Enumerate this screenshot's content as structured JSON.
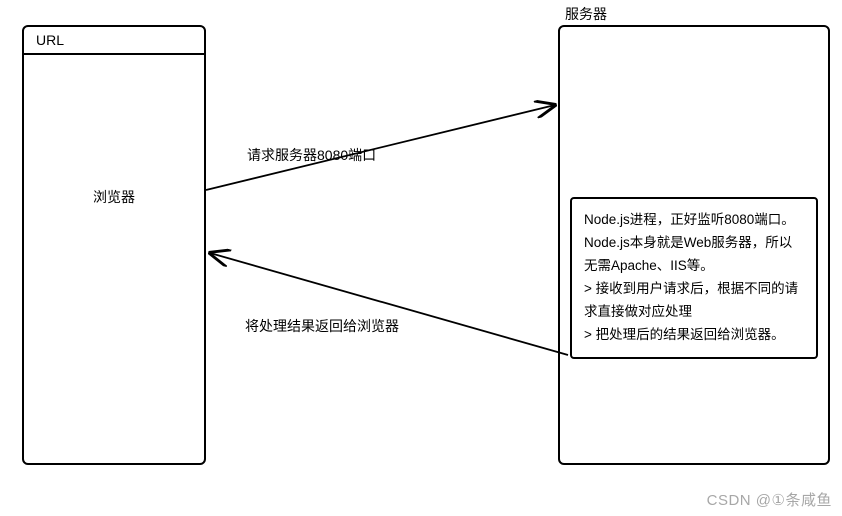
{
  "browser": {
    "url_label": "URL",
    "name": "浏览器"
  },
  "server": {
    "title": "服务器",
    "node_desc": "Node.js进程，正好监听8080端口。Node.js本身就是Web服务器，所以无需Apache、IIS等。",
    "bullet1": "> 接收到用户请求后，根据不同的请求直接做对应处理",
    "bullet2": "> 把处理后的结果返回给浏览器。"
  },
  "arrows": {
    "request_label": "请求服务器8080端口",
    "response_label": "将处理结果返回给浏览器"
  },
  "watermark": "CSDN @①条咸鱼"
}
